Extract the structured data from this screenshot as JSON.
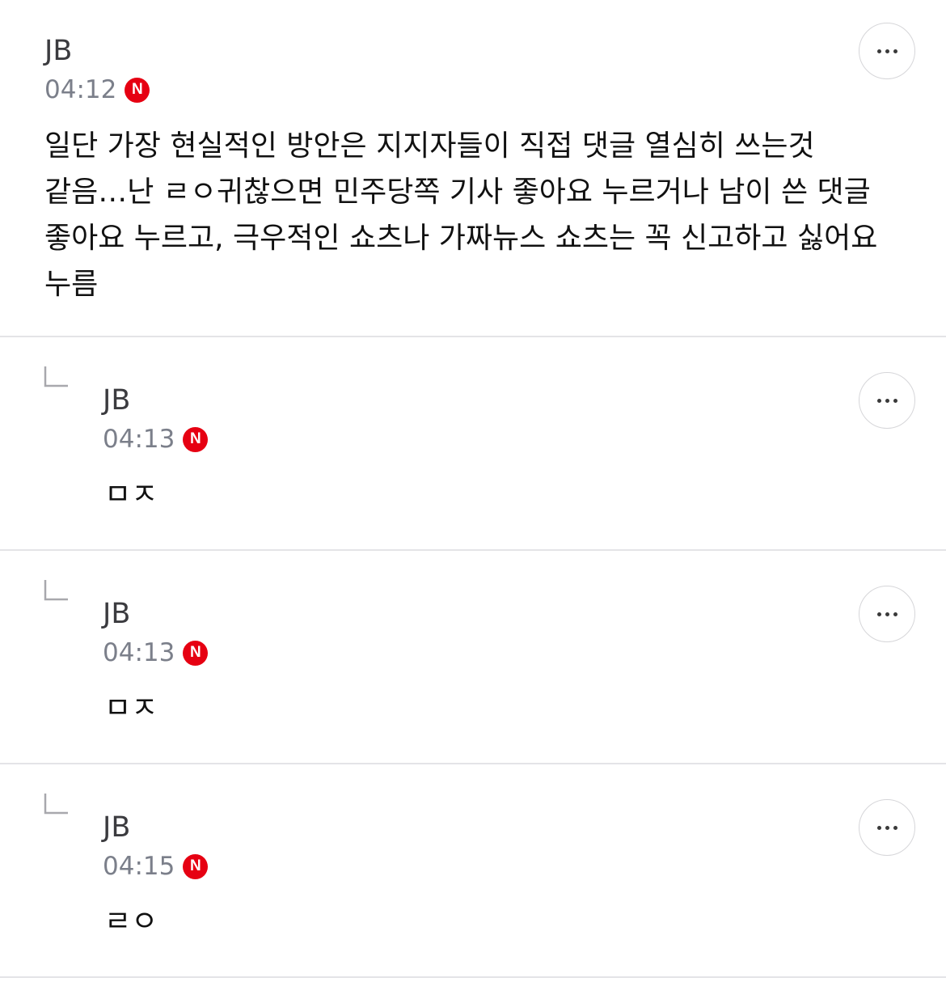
{
  "comments": [
    {
      "author": "JB",
      "time": "04:12",
      "badge": "N",
      "text": "일단 가장 현실적인 방안은 지지자들이 직접 댓글 열심히 쓰는것 같음…난 ㄹㅇ귀찮으면 민주당쪽 기사 좋아요 누르거나 남이 쓴 댓글 좋아요 누르고, 극우적인 쇼츠나 가짜뉴스 쇼츠는 꼭 신고하고 싫어요 누름",
      "more_icon": "more-horizontal-icon"
    }
  ],
  "replies": [
    {
      "author": "JB",
      "time": "04:13",
      "badge": "N",
      "text": "ㅁㅈ",
      "reply_icon": "reply-arrow-icon",
      "more_icon": "more-horizontal-icon"
    },
    {
      "author": "JB",
      "time": "04:13",
      "badge": "N",
      "text": "ㅁㅈ",
      "reply_icon": "reply-arrow-icon",
      "more_icon": "more-horizontal-icon"
    },
    {
      "author": "JB",
      "time": "04:15",
      "badge": "N",
      "text": "ㄹㅇ",
      "reply_icon": "reply-arrow-icon",
      "more_icon": "more-horizontal-icon"
    }
  ],
  "colors": {
    "badge": "#e60012",
    "divider": "#e4e4e7",
    "time": "#7b7f8a",
    "author": "#3b3b3f"
  }
}
